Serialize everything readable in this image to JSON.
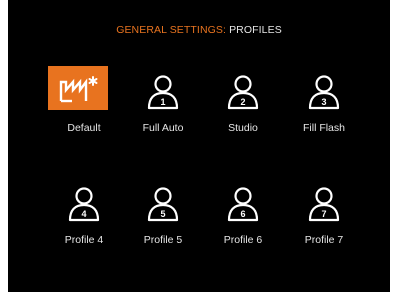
{
  "header": {
    "section": "GENERAL SETTINGS:",
    "page": "PROFILES"
  },
  "accent_color": "#e8731f",
  "profiles": [
    {
      "label": "Default",
      "icon": "factory-icon",
      "selected": true
    },
    {
      "label": "Full Auto",
      "number": "1",
      "icon": "user-profile-icon"
    },
    {
      "label": "Studio",
      "number": "2",
      "icon": "user-profile-icon"
    },
    {
      "label": "Fill Flash",
      "number": "3",
      "icon": "user-profile-icon"
    },
    {
      "label": "Profile 4",
      "number": "4",
      "icon": "user-profile-icon"
    },
    {
      "label": "Profile 5",
      "number": "5",
      "icon": "user-profile-icon"
    },
    {
      "label": "Profile 6",
      "number": "6",
      "icon": "user-profile-icon"
    },
    {
      "label": "Profile 7",
      "number": "7",
      "icon": "user-profile-icon"
    }
  ]
}
